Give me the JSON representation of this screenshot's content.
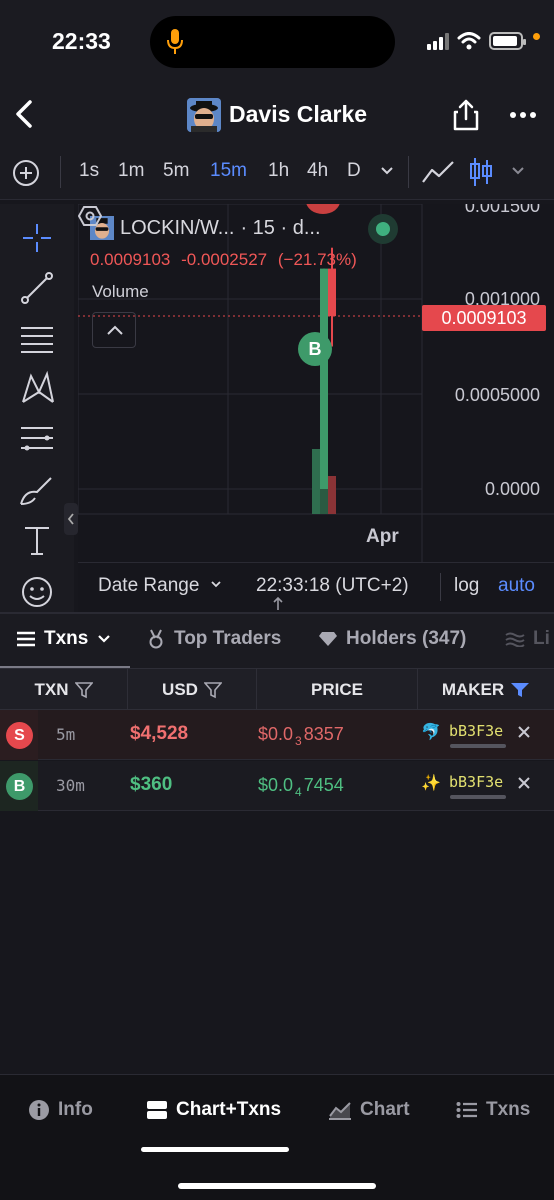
{
  "status": {
    "time": "22:33"
  },
  "header": {
    "title": "Davis Clarke"
  },
  "timeframes": [
    {
      "label": "1s",
      "active": false
    },
    {
      "label": "1m",
      "active": false
    },
    {
      "label": "5m",
      "active": false
    },
    {
      "label": "15m",
      "active": true
    },
    {
      "label": "1h",
      "active": false
    },
    {
      "label": "4h",
      "active": false
    },
    {
      "label": "D",
      "active": false
    }
  ],
  "chart": {
    "symbol": "LOCKIN/W...",
    "interval": "· 15 · d...",
    "last_price": "0.0009103",
    "change": "-0.0002527",
    "change_pct": "(−21.73%)",
    "volume_label": "Volume",
    "price_tag": "0.0009103",
    "y_ticks": [
      "0.001500",
      "0.001000",
      "0.0005000",
      "0.0000"
    ],
    "x_label": "Apr",
    "buy_marker": "B",
    "footer": {
      "date_range": "Date Range",
      "clock": "22:33:18 (UTC+2)",
      "log": "log",
      "auto": "auto"
    },
    "colors": {
      "up": "#3e9a6a",
      "down": "#e5484d",
      "accent": "#5b8cff"
    }
  },
  "chart_data": {
    "type": "candlestick",
    "title": "LOCKIN/W...",
    "ylim": [
      0,
      0.0015
    ],
    "y_ticks": [
      0.0015,
      0.001,
      0.0005,
      0.0
    ],
    "last_price": 0.0009103,
    "candles": [
      {
        "index": 0,
        "open": 0.0,
        "close": 0.00116,
        "high": 0.00116,
        "low": 0.0,
        "direction": "up"
      },
      {
        "index": 1,
        "open": 0.00116,
        "close": 0.00091,
        "high": 0.00127,
        "low": 0.00075,
        "direction": "down"
      }
    ]
  },
  "tabs": [
    {
      "label": "Txns",
      "active": true
    },
    {
      "label": "Top Traders",
      "active": false
    },
    {
      "label": "Holders (347)",
      "active": false
    },
    {
      "label": "Li",
      "active": false
    }
  ],
  "table": {
    "headers": [
      "TXN",
      "USD",
      "PRICE",
      "MAKER"
    ],
    "rows": [
      {
        "type": "S",
        "age": "5m",
        "usd": "$4,528",
        "price_main": "$0.0",
        "price_sub": "3",
        "price_tail": "8357",
        "maker": "bB3F3e",
        "maker_icon": "dolphin-icon"
      },
      {
        "type": "B",
        "age": "30m",
        "usd": "$360",
        "price_main": "$0.0",
        "price_sub": "4",
        "price_tail": "7454",
        "maker": "bB3F3e",
        "maker_icon": "sparkle-dolphin-icon"
      }
    ]
  },
  "bottom_nav": [
    {
      "label": "Info",
      "icon": "info-icon",
      "active": false
    },
    {
      "label": "Chart+Txns",
      "icon": "split-icon",
      "active": true
    },
    {
      "label": "Chart",
      "icon": "chart-icon",
      "active": false
    },
    {
      "label": "Txns",
      "icon": "list-icon",
      "active": false
    }
  ]
}
